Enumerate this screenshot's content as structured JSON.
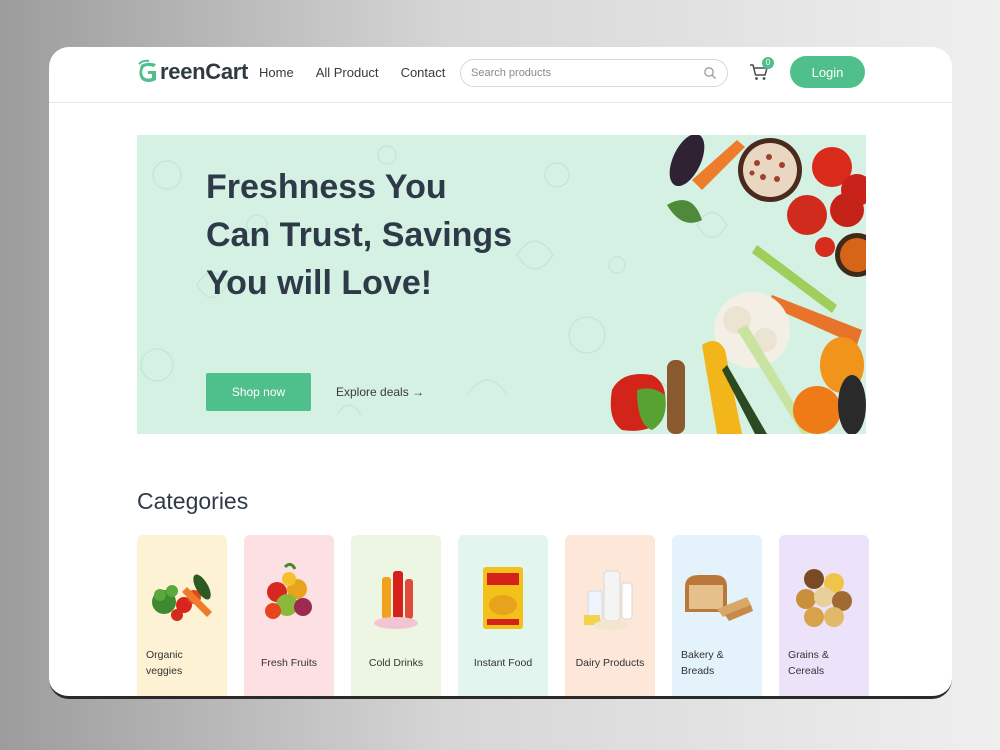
{
  "brand": {
    "logo_text": "reenCart",
    "logo_letter": "G",
    "accent": "#4fbf8b"
  },
  "nav": {
    "links": [
      "Home",
      "All Product",
      "Contact"
    ],
    "search_placeholder": "Search products",
    "cart_count": "0",
    "login_label": "Login"
  },
  "hero": {
    "title": "Freshness You Can Trust, Savings You will Love!",
    "shop_label": "Shop now",
    "explore_label": "Explore deals",
    "explore_arrow": "→",
    "background": "#d4f1e3"
  },
  "categories": {
    "title": "Categories",
    "items": [
      {
        "label": "Organic veggies",
        "bg": "#fdf2d4",
        "icon": "veggies-icon"
      },
      {
        "label": "Fresh Fruits",
        "bg": "#fde0e3",
        "icon": "fruits-icon"
      },
      {
        "label": "Cold Drinks",
        "bg": "#edf6e3",
        "icon": "drinks-icon"
      },
      {
        "label": "Instant Food",
        "bg": "#e2f5ef",
        "icon": "noodles-icon"
      },
      {
        "label": "Dairy Products",
        "bg": "#fde7d8",
        "icon": "dairy-icon"
      },
      {
        "label": "Bakery & Breads",
        "bg": "#e3f2fb",
        "icon": "bread-icon"
      },
      {
        "label": "Grains & Cereals",
        "bg": "#ece3fb",
        "icon": "grains-icon"
      }
    ]
  }
}
